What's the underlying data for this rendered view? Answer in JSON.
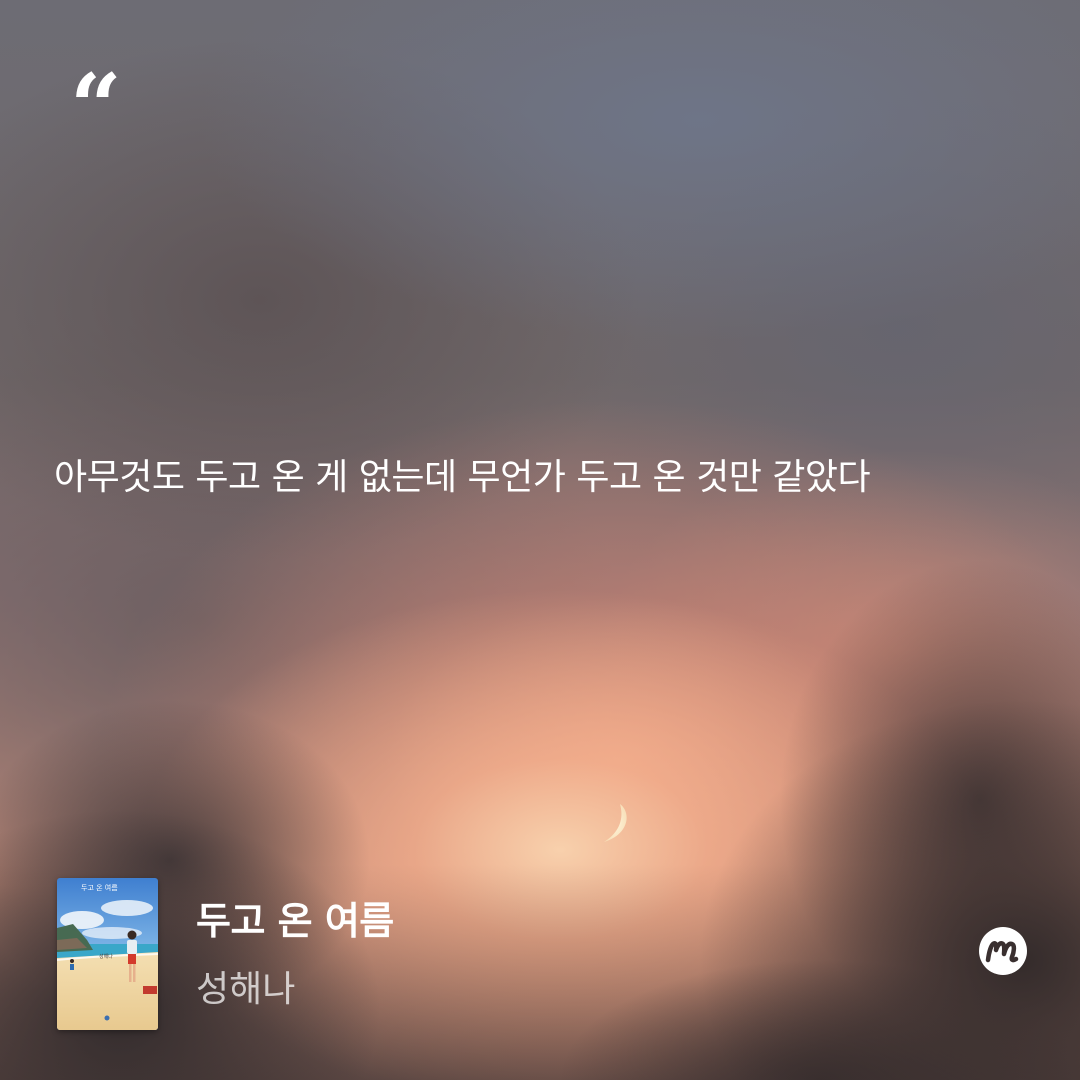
{
  "quote": {
    "text": "아무것도 두고 온 게 없는데 무언가 두고 온 것만 같았다",
    "icon": "opening-quote-icon"
  },
  "book": {
    "title": "두고 온 여름",
    "author": "성해나",
    "cover_title": "두고 온 여름",
    "cover_author": "성해나"
  },
  "brand": {
    "icon": "app-logo-m-icon"
  },
  "colors": {
    "text": "#ffffff",
    "author_text": "rgba(255,255,255,0.72)"
  }
}
